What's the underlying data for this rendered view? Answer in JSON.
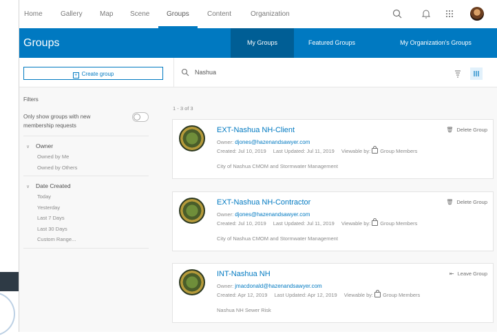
{
  "nav": {
    "items": [
      "Home",
      "Gallery",
      "Map",
      "Scene",
      "Groups",
      "Content",
      "Organization"
    ],
    "active": "Groups"
  },
  "header": {
    "title": "Groups",
    "tabs": [
      "My Groups",
      "Featured Groups",
      "My Organization's Groups"
    ],
    "active_tab": "My Groups"
  },
  "toolbar": {
    "create_label": "Create group",
    "search_value": "Nashua"
  },
  "sidebar": {
    "filters_label": "Filters",
    "toggle_label": "Only show groups with new membership requests",
    "toggle_on": false,
    "owner": {
      "label": "Owner",
      "options": [
        "Owned by Me",
        "Owned by Others"
      ]
    },
    "date_created": {
      "label": "Date Created",
      "options": [
        "Today",
        "Yesterday",
        "Last 7 Days",
        "Last 30 Days",
        "Custom Range..."
      ]
    }
  },
  "results": {
    "count": "1 - 3 of 3",
    "groups": [
      {
        "name": "EXT-Nashua NH-Client",
        "owner_label": "Owner:",
        "owner": "djones@hazenandsawyer.com",
        "created": "Created: Jul 10, 2019",
        "updated": "Last Updated: Jul 11, 2019",
        "viewable_label": "Viewable by:",
        "viewable": "Group Members",
        "description": "City of Nashua CMOM and Stormwater Management",
        "action": "Delete Group"
      },
      {
        "name": "EXT-Nashua NH-Contractor",
        "owner_label": "Owner:",
        "owner": "djones@hazenandsawyer.com",
        "created": "Created: Jul 10, 2019",
        "updated": "Last Updated: Jul 11, 2019",
        "viewable_label": "Viewable by:",
        "viewable": "Group Members",
        "description": "City of Nashua CMOM and Stormwater Management",
        "action": "Delete Group"
      },
      {
        "name": "INT-Nashua NH",
        "owner_label": "Owner:",
        "owner": "jmacdonald@hazenandsawyer.com",
        "created": "Created: Apr 12, 2019",
        "updated": "Last Updated: Apr 12, 2019",
        "viewable_label": "Viewable by:",
        "viewable": "Group Members",
        "description": "Nashua NH Sewer Risk",
        "action": "Leave Group"
      }
    ]
  },
  "colors": {
    "accent": "#0079c1",
    "accent_dark": "#005e95"
  }
}
